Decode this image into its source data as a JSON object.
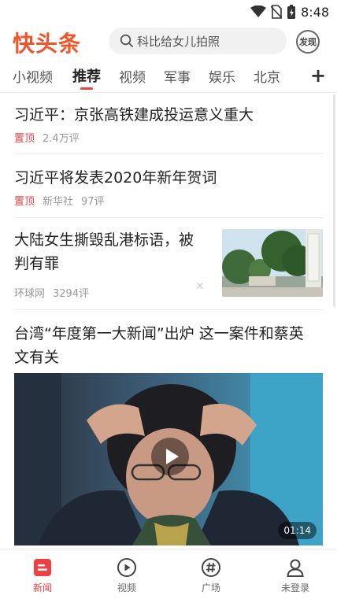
{
  "status_bar": {
    "time": "8:48"
  },
  "header": {
    "logo": "快头条",
    "search_placeholder": "科比给女儿拍照",
    "discover_label": "发现"
  },
  "tabs": [
    {
      "label": "小视频"
    },
    {
      "label": "推荐"
    },
    {
      "label": "视频"
    },
    {
      "label": "军事"
    },
    {
      "label": "娱乐"
    },
    {
      "label": "北京"
    }
  ],
  "active_tab": "推荐",
  "articles": [
    {
      "title": "习近平：京张高铁建成投运意义重大",
      "pin": "置顶",
      "source": "",
      "comments": "2.4万评"
    },
    {
      "title": "习近平将发表2020年新年贺词",
      "pin": "置顶",
      "source": "新华社",
      "comments": "97评"
    },
    {
      "title_line1": "大陆女生撕毁乱港标语，被",
      "title_line2": "判有罪",
      "source": "环球网",
      "comments": "3294评"
    },
    {
      "title_line1": "台湾“年度第一大新闻”出炉 这一案件和蔡英",
      "title_line2": "文有关",
      "duration": "01:14"
    }
  ],
  "bottom_nav": [
    {
      "label": "新闻",
      "icon": "news-icon",
      "active": true
    },
    {
      "label": "视频",
      "icon": "play-circle-icon",
      "active": false
    },
    {
      "label": "广场",
      "icon": "hashtag-icon",
      "active": false
    },
    {
      "label": "未登录",
      "icon": "user-icon",
      "active": false
    }
  ],
  "colors": {
    "accent": "#f04142",
    "logo": "#f0542b"
  }
}
